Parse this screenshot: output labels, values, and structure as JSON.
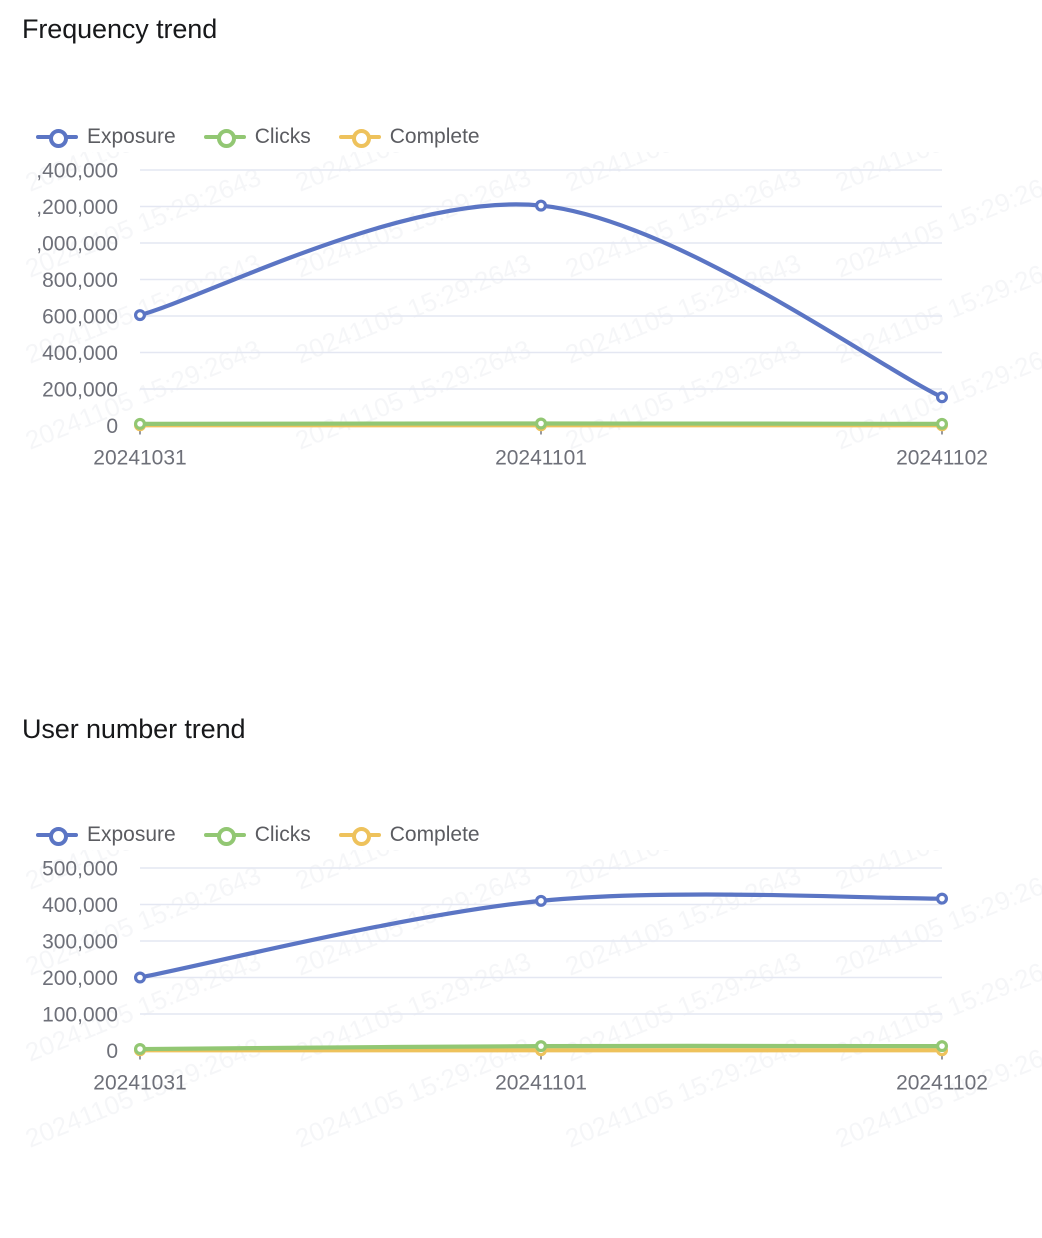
{
  "page": {
    "background": "#ffffff",
    "watermark": "20241105 15:29:2643"
  },
  "palette": {
    "exposure": "#5b75c4",
    "clicks": "#92c773",
    "complete": "#eec25c",
    "grid": "#e4e7f2",
    "axis_text": "#6e7079",
    "title_text": "#17181a",
    "legend_text": "#5b5c61"
  },
  "sections": [
    {
      "id": "frequency",
      "title": "Frequency trend",
      "legend": [
        {
          "label": "Exposure",
          "color_key": "exposure",
          "icon": "line-circle-marker-icon"
        },
        {
          "label": "Clicks",
          "color_key": "clicks",
          "icon": "line-circle-marker-icon"
        },
        {
          "label": "Complete",
          "color_key": "complete",
          "icon": "line-circle-marker-icon"
        }
      ]
    },
    {
      "id": "users",
      "title": "User number trend",
      "legend": [
        {
          "label": "Exposure",
          "color_key": "exposure",
          "icon": "line-circle-marker-icon"
        },
        {
          "label": "Clicks",
          "color_key": "clicks",
          "icon": "line-circle-marker-icon"
        },
        {
          "label": "Complete",
          "color_key": "complete",
          "icon": "line-circle-marker-icon"
        }
      ]
    }
  ],
  "chart_data": [
    {
      "id": "frequency",
      "type": "line",
      "title": "Frequency trend",
      "xlabel": "",
      "ylabel": "",
      "grid": true,
      "legend_position": "top-left",
      "smooth": true,
      "categories": [
        "20241031",
        "20241101",
        "20241102"
      ],
      "x_tick_labels": [
        "20241031",
        "20241101",
        "20241102"
      ],
      "y_tick_labels": [
        ",400,000",
        ",200,000",
        ",000,000",
        "800,000",
        "600,000",
        "400,000",
        "200,000",
        "0"
      ],
      "y_tick_values": [
        1400000,
        1200000,
        1000000,
        800000,
        600000,
        400000,
        200000,
        0
      ],
      "ylim": [
        0,
        1400000
      ],
      "note": "Y axis labels for 1,400,000 / 1,200,000 / 1,000,000 are clipped at the left edge of the image, showing only ',400,000' / ',200,000' / ',000,000'.",
      "series": [
        {
          "name": "Exposure",
          "color_key": "exposure",
          "values": [
            605000,
            1205000,
            155000
          ]
        },
        {
          "name": "Clicks",
          "color_key": "clicks",
          "values": [
            9000,
            11000,
            9000
          ]
        },
        {
          "name": "Complete",
          "color_key": "complete",
          "values": [
            1500,
            1500,
            1500
          ]
        }
      ]
    },
    {
      "id": "users",
      "type": "line",
      "title": "User number trend",
      "xlabel": "",
      "ylabel": "",
      "grid": true,
      "legend_position": "top-left",
      "smooth": true,
      "categories": [
        "20241031",
        "20241101",
        "20241102"
      ],
      "x_tick_labels": [
        "20241031",
        "20241101",
        "20241102"
      ],
      "y_tick_labels": [
        "500,000",
        "400,000",
        "300,000",
        "200,000",
        "100,000",
        "0"
      ],
      "y_tick_values": [
        500000,
        400000,
        300000,
        200000,
        100000,
        0
      ],
      "ylim": [
        0,
        500000
      ],
      "series": [
        {
          "name": "Exposure",
          "color_key": "exposure",
          "values": [
            200000,
            410000,
            416000
          ]
        },
        {
          "name": "Clicks",
          "color_key": "clicks",
          "values": [
            4000,
            12000,
            12000
          ]
        },
        {
          "name": "Complete",
          "color_key": "complete",
          "values": [
            600,
            600,
            600
          ]
        }
      ]
    }
  ]
}
